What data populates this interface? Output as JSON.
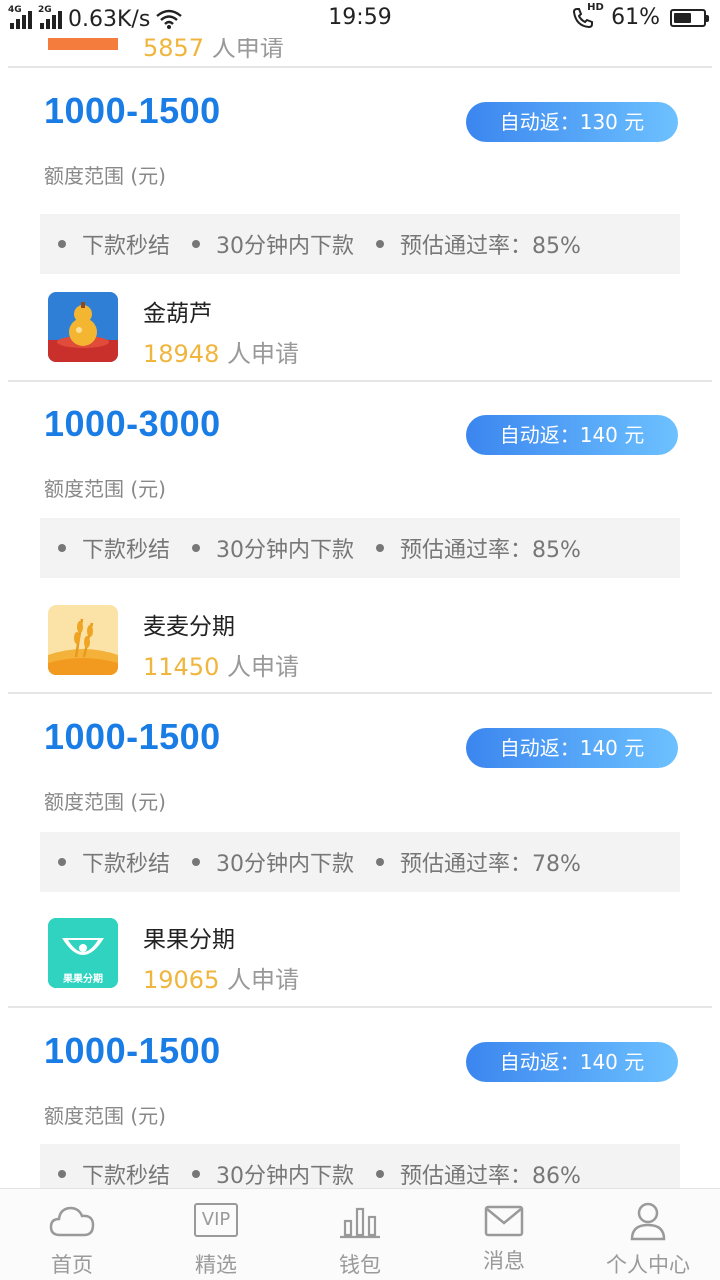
{
  "status_bar": {
    "signal1_tag": "4G",
    "signal2_tag": "2G",
    "speed": "0.63K/s",
    "time": "19:59",
    "hd": "HD",
    "battery": "61%",
    "battery_level": 0.61
  },
  "top_partial": {
    "count": "5857",
    "count_suffix": " 人申请"
  },
  "offers": [
    {
      "amount": "1000-1500",
      "cashback": "自动返：130 元",
      "range_label": "额度范围 (元)",
      "features": [
        "下款秒结",
        "30分钟内下款",
        "预估通过率：85%"
      ],
      "lender": {
        "name": "金葫芦",
        "count": "18948",
        "count_suffix": " 人申请",
        "icon": "gourd-app-icon"
      }
    },
    {
      "amount": "1000-3000",
      "cashback": "自动返：140 元",
      "range_label": "额度范围 (元)",
      "features": [
        "下款秒结",
        "30分钟内下款",
        "预估通过率：85%"
      ],
      "lender": {
        "name": "麦麦分期",
        "count": "11450",
        "count_suffix": " 人申请",
        "icon": "wheat-app-icon"
      }
    },
    {
      "amount": "1000-1500",
      "cashback": "自动返：140 元",
      "range_label": "额度范围 (元)",
      "features": [
        "下款秒结",
        "30分钟内下款",
        "预估通过率：78%"
      ],
      "lender": {
        "name": "果果分期",
        "count": "19065",
        "count_suffix": " 人申请",
        "icon": "guoguo-app-icon",
        "icon_text": "果果分期"
      }
    },
    {
      "amount": "1000-1500",
      "cashback": "自动返：140 元",
      "range_label": "额度范围 (元)",
      "features": [
        "下款秒结",
        "30分钟内下款",
        "预估通过率：86%"
      ]
    }
  ],
  "tabs": [
    {
      "label": "首页",
      "icon": "cloud-icon"
    },
    {
      "label": "精选",
      "icon": "vip-icon",
      "icon_text": "VIP"
    },
    {
      "label": "钱包",
      "icon": "bar-chart-icon"
    },
    {
      "label": "消息",
      "icon": "mail-icon"
    },
    {
      "label": "个人中心",
      "icon": "person-icon"
    }
  ],
  "colors": {
    "amount": "#1a7de6",
    "count": "#f0b53c",
    "cashback_start": "#3b86ef",
    "cashback_end": "#6dc1ff",
    "tab_inactive": "#9a9a9a"
  }
}
